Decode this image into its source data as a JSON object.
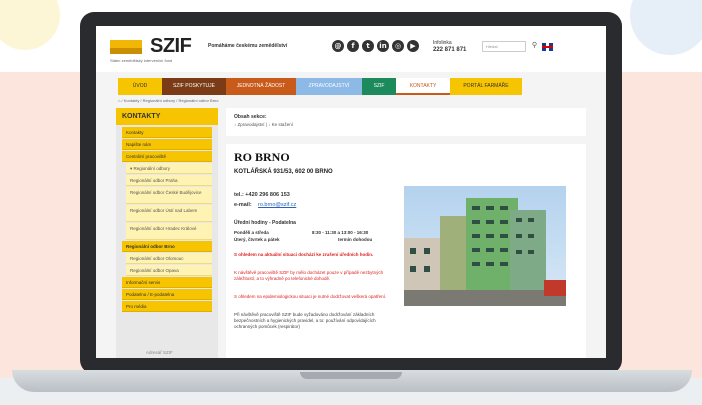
{
  "brand": {
    "logo_text": "SZIF",
    "logo_sub": "Státní zemědělský intervenční fond",
    "tagline": "Pomáháme českému zemědělství"
  },
  "social": [
    {
      "glyph": "@",
      "icon": "mail-icon"
    },
    {
      "glyph": "f",
      "icon": "facebook-icon"
    },
    {
      "glyph": "t",
      "icon": "twitter-icon"
    },
    {
      "glyph": "in",
      "icon": "linkedin-icon"
    },
    {
      "glyph": "◎",
      "icon": "instagram-icon"
    },
    {
      "glyph": "▶",
      "icon": "youtube-icon"
    }
  ],
  "infolinka": {
    "label": "Infolinka",
    "number": "222 871 871"
  },
  "search": {
    "placeholder": "Hledat"
  },
  "nav": [
    {
      "label": "ÚVOD",
      "bg": "#f6c400",
      "color": "#333",
      "w": 44
    },
    {
      "label": "SZIF POSKYTUJE",
      "bg": "#7a3b16",
      "color": "#fff",
      "w": 64
    },
    {
      "label": "JEDNOTNÁ ŽÁDOST",
      "bg": "#c85a1a",
      "color": "#fff",
      "w": 70
    },
    {
      "label": "ZPRAVODAJSTVÍ",
      "bg": "#8cb9e6",
      "color": "#fff",
      "w": 66
    },
    {
      "label": "SZIF",
      "bg": "#1c8a5a",
      "color": "#fff",
      "w": 34
    },
    {
      "label": "KONTAKTY",
      "bg": "#ffffff",
      "color": "#c85a1a",
      "w": 54
    },
    {
      "label": "PORTÁL FARMÁŘE",
      "bg": "#f6c400",
      "color": "#333",
      "w": 72
    }
  ],
  "breadcrumb": "⌂ / Kontakty / Regionální odbory / Regionální odbor Brno",
  "sidebar": {
    "title": "KONTAKTY",
    "items": [
      {
        "label": "Kontakty",
        "type": "main"
      },
      {
        "label": "Napište nám",
        "type": "main"
      },
      {
        "label": "Centrální pracoviště",
        "type": "main"
      },
      {
        "label": "▾ Regionální odbory",
        "type": "sub"
      },
      {
        "label": "Regionální odbor Praha",
        "type": "sub"
      },
      {
        "label": "Regionální odbor České Budějovice",
        "type": "sub"
      },
      {
        "label": "Regionální odbor Ústí nad Labem",
        "type": "sub"
      },
      {
        "label": "Regionální odbor Hradec Králové",
        "type": "sub"
      },
      {
        "label": "Regionální odbor Brno",
        "type": "act"
      },
      {
        "label": "Regionální odbor Olomouc",
        "type": "sub"
      },
      {
        "label": "Regionální odbor Opava",
        "type": "sub"
      },
      {
        "label": "Informační servis",
        "type": "main"
      },
      {
        "label": "Podatelna / E-podatelna",
        "type": "main"
      },
      {
        "label": "Pro média",
        "type": "main"
      }
    ],
    "footer": "Adresář SZIF"
  },
  "content": {
    "section_label": "Obsah sekce:",
    "section_links": "↓ Zpravodajství | ↓ Ke stažení",
    "title": "RO BRNO",
    "address": "KOTLÁŘSKÁ 931/53, 602 00 BRNO",
    "phone": "tel.: +420 296 806 153",
    "email_label": "e-mail:",
    "email": "ro.brno@szif.cz",
    "hours_title": "Úřední hodiny - Podatelna",
    "hours_1_days": "Pondělí a středa",
    "hours_1_time": "8:30 - 11:30 a 13:00 - 16:30",
    "hours_2_days": "Úterý, čtvrtek a pátek",
    "hours_2_time": "termín dohodou",
    "notice_1": "S ohledem na aktuální situaci dochází ke zrušení úředních hodin.",
    "notice_2": "K návštěvě pracoviště SZIF by mělo docházet pouze v případě nezbytných záležitostí, a to výhradně po telefonické dohodě.",
    "notice_3": "S ohledem na epidemiologickou situaci je nutné dodržovat veškerá opatření.",
    "paragraph": "Při návštěvě pracoviště SZIF bude vyžadováno dodržování základních bezpečnostních a hygienických pravidel, a to: používání odpovídajících ochranných pomůcek (respirátor)"
  }
}
